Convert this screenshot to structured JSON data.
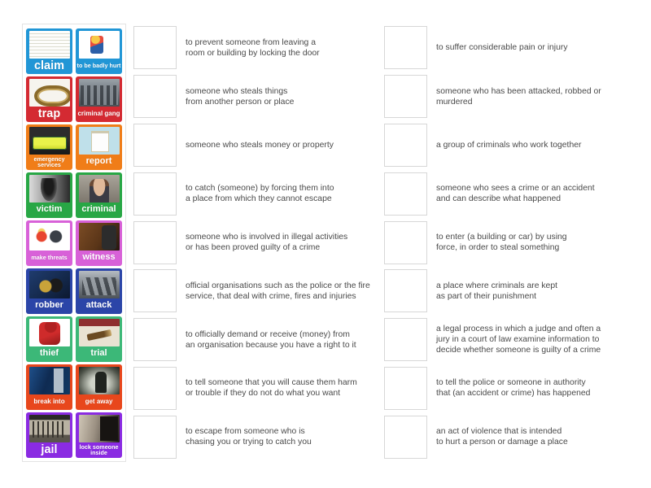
{
  "app": {
    "type": "match-up-drag-and-drop-activity",
    "background_color": "#ffffff"
  },
  "tile_panel": {
    "border_color": "#e3e3e3",
    "tiles": [
      {
        "label": "claim",
        "color": "#2196d6",
        "label_size": "lg",
        "image": "p-claim",
        "row": 1,
        "col": 1
      },
      {
        "label": "to be\nbadly hurt",
        "color": "#2196d6",
        "label_size": "xs",
        "image": "p-badlyhurt",
        "row": 1,
        "col": 2
      },
      {
        "label": "trap",
        "color": "#d42a32",
        "label_size": "lg",
        "image": "p-trap",
        "row": 2,
        "col": 1
      },
      {
        "label": "criminal\ngang",
        "color": "#d42a32",
        "label_size": "sm",
        "image": "p-gang",
        "row": 2,
        "col": 2
      },
      {
        "label": "emergency\nservices",
        "color": "#f07d18",
        "label_size": "xs",
        "image": "p-ambulance",
        "row": 3,
        "col": 1
      },
      {
        "label": "report",
        "color": "#f07d18",
        "label_size": "md",
        "image": "p-report",
        "row": 3,
        "col": 2
      },
      {
        "label": "victim",
        "color": "#28a745",
        "label_size": "md",
        "image": "p-victim",
        "row": 4,
        "col": 1
      },
      {
        "label": "criminal",
        "color": "#28a745",
        "label_size": "md",
        "image": "p-criminal",
        "row": 4,
        "col": 2
      },
      {
        "label": "make threats",
        "color": "#d861d8",
        "label_size": "xs",
        "image": "p-threats",
        "row": 5,
        "col": 1
      },
      {
        "label": "witness",
        "color": "#d861d8",
        "label_size": "md",
        "image": "p-witness",
        "row": 5,
        "col": 2
      },
      {
        "label": "robber",
        "color": "#2b45a8",
        "label_size": "md",
        "image": "p-robber",
        "row": 6,
        "col": 1
      },
      {
        "label": "attack",
        "color": "#2b45a8",
        "label_size": "md",
        "image": "p-attack",
        "row": 6,
        "col": 2
      },
      {
        "label": "thief",
        "color": "#3cb878",
        "label_size": "md",
        "image": "p-thief",
        "row": 7,
        "col": 1
      },
      {
        "label": "trial",
        "color": "#3cb878",
        "label_size": "md",
        "image": "p-trial",
        "row": 7,
        "col": 2
      },
      {
        "label": "break into",
        "color": "#e8471c",
        "label_size": "sm",
        "image": "p-breakinto",
        "row": 8,
        "col": 1
      },
      {
        "label": "get away",
        "color": "#e8471c",
        "label_size": "sm",
        "image": "p-getaway",
        "row": 8,
        "col": 2
      },
      {
        "label": "jail",
        "color": "#8a2be2",
        "label_size": "lg",
        "image": "p-jail",
        "row": 9,
        "col": 1
      },
      {
        "label": "lock someone\ninside",
        "color": "#8a2be2",
        "label_size": "xs",
        "image": "p-locksomeone",
        "row": 9,
        "col": 2
      }
    ]
  },
  "definitions_middle": [
    {
      "text": "to prevent someone from leaving a\nroom or building by locking the door"
    },
    {
      "text": "someone who steals things\nfrom another person or place"
    },
    {
      "text": "someone who steals money or property"
    },
    {
      "text": "to catch (someone) by forcing them into\na place from which they cannot escape"
    },
    {
      "text": "someone who is involved in illegal activities\nor has been proved guilty of a crime"
    },
    {
      "text": "official organisations such as the police or the fire\nservice, that deal with crime, fires and injuries"
    },
    {
      "text": "to officially demand or receive (money) from\nan organisation because you have a right to it"
    },
    {
      "text": "to tell someone that you will cause them harm\nor trouble if they do not do what you want"
    },
    {
      "text": "to escape from someone who is\nchasing you or trying to catch you"
    }
  ],
  "definitions_right": [
    {
      "text": "to suffer considerable pain or injury"
    },
    {
      "text": "someone who has been attacked, robbed or murdered"
    },
    {
      "text": "a group of criminals who work together"
    },
    {
      "text": "someone who sees a crime or an accident\nand can describe what happened"
    },
    {
      "text": "to enter (a building or car) by using\nforce, in order to steal something"
    },
    {
      "text": "a place where criminals are kept\nas part of their punishment"
    },
    {
      "text": "a legal process in which a judge and often a\njury in a court of law examine information to\ndecide whether someone is guilty of a crime"
    },
    {
      "text": "to tell the police or someone in authority\nthat (an accident or crime) has happened"
    },
    {
      "text": "an act of violence that is intended\nto hurt a person or damage a place"
    }
  ]
}
